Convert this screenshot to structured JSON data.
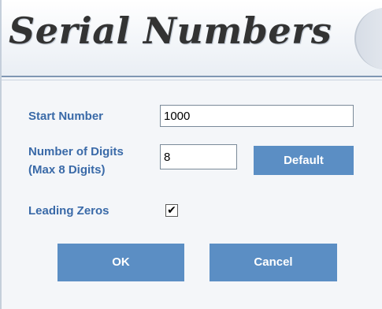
{
  "header": {
    "title": "Serial Numbers"
  },
  "form": {
    "start_number": {
      "label": "Start Number",
      "value": "1000"
    },
    "number_of_digits": {
      "label_line1": "Number of Digits",
      "label_line2": "(Max 8 Digits)",
      "value": "8"
    },
    "default_label": "Default",
    "leading_zeros": {
      "label": "Leading Zeros",
      "checked": true,
      "check_glyph": "✔"
    }
  },
  "buttons": {
    "ok_label": "OK",
    "cancel_label": "Cancel"
  },
  "colors": {
    "label": "#3a6aa8",
    "button": "#5b8ec4",
    "button_text": "#ffffff"
  }
}
